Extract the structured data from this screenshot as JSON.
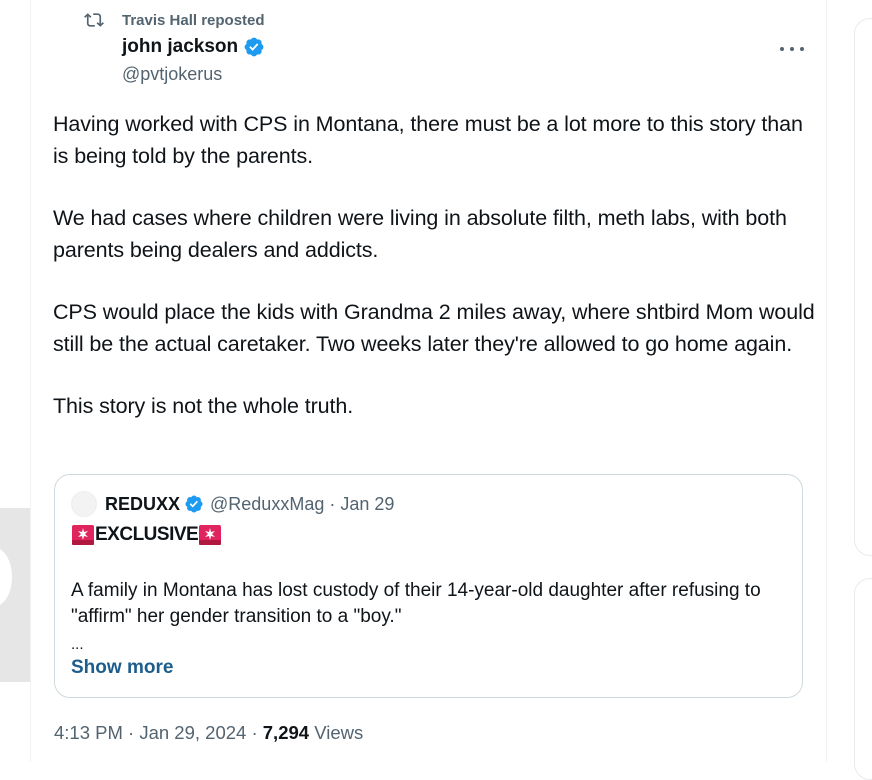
{
  "repost": {
    "label": "Travis Hall reposted"
  },
  "author": {
    "name": "john jackson",
    "handle": "@pvtjokerus"
  },
  "tweet": {
    "paragraphs": [
      "Having worked with CPS in Montana, there must be a lot more to this story than is being told by the parents.",
      "We had cases where children were living in absolute filth, meth labs, with both parents being dealers and addicts.",
      "CPS would place the kids with Grandma 2 miles away, where shtbird Mom would still be the actual caretaker. Two weeks later they're allowed to go home again.",
      "This story is not the whole truth."
    ]
  },
  "quote": {
    "name": "REDUXX",
    "handle_date": "@ReduxxMag · Jan 29",
    "tag": "EXCLUSIVE",
    "text": "A family in Montana has lost custody of their 14-year-old daughter after refusing to \"affirm\" her gender transition to a \"boy.\"",
    "ellipsis": "...",
    "show_more": "Show more"
  },
  "footer": {
    "time_date": "4:13 PM · Jan 29, 2024 · ",
    "views_count": "7,294",
    "views_label": " Views"
  },
  "icons": {
    "repost": "repost-icon",
    "verified": "verified-badge-icon",
    "more": "more-options-icon",
    "siren": "police-light-icon"
  },
  "colors": {
    "verified": "#1d9bf0",
    "secondary_text": "#536471",
    "link": "#1d5d8c",
    "siren": "#e0245e"
  }
}
